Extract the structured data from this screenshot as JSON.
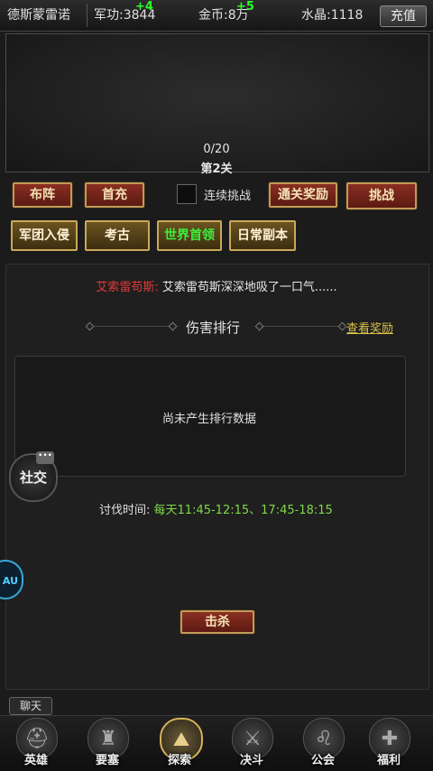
{
  "topbar": {
    "name": "德斯蒙雷诺",
    "merit_label": "军功:",
    "merit_value": "3844",
    "merit_delta": "+4",
    "gold_label": "金币:",
    "gold_value": "8万",
    "gold_delta": "+5",
    "crystal_label": "水晶:",
    "crystal_value": "1118",
    "recharge": "充值"
  },
  "stage": {
    "progress": "0/20",
    "level": "第2关"
  },
  "actions": {
    "formation": "布阵",
    "first_recharge": "首充",
    "continuous": "连续挑战",
    "clear_reward": "通关奖励",
    "challenge": "挑战"
  },
  "modes": [
    "军团入侵",
    "考古",
    "世界首领",
    "日常副本"
  ],
  "message": {
    "speaker": "艾索雷苟斯:",
    "text": "艾索雷苟斯深深地吸了一口气......"
  },
  "ranking": {
    "title": "伤害排行",
    "view_reward": "查看奖励",
    "empty": "尚未产生排行数据"
  },
  "schedule": {
    "label": "讨伐时间:",
    "value": "每天11:45-12:15、17:45-18:15"
  },
  "kill_button": "击杀",
  "social": "社交",
  "social_bubble": "•••",
  "side_badge": "AU",
  "chat": "聊天",
  "nav": [
    {
      "label": "英雄",
      "icon": "helmet-icon"
    },
    {
      "label": "要塞",
      "icon": "fortress-icon"
    },
    {
      "label": "探索",
      "icon": "map-icon"
    },
    {
      "label": "决斗",
      "icon": "crossed-swords-icon"
    },
    {
      "label": "公会",
      "icon": "lion-icon"
    },
    {
      "label": "福利",
      "icon": "gift-icon"
    }
  ],
  "colors": {
    "delta": "#2cff2c",
    "speaker": "#e23a3a",
    "schedule_value": "#7fd84a",
    "world_boss": "#3cf03c",
    "view_reward": "#d8c24a"
  }
}
